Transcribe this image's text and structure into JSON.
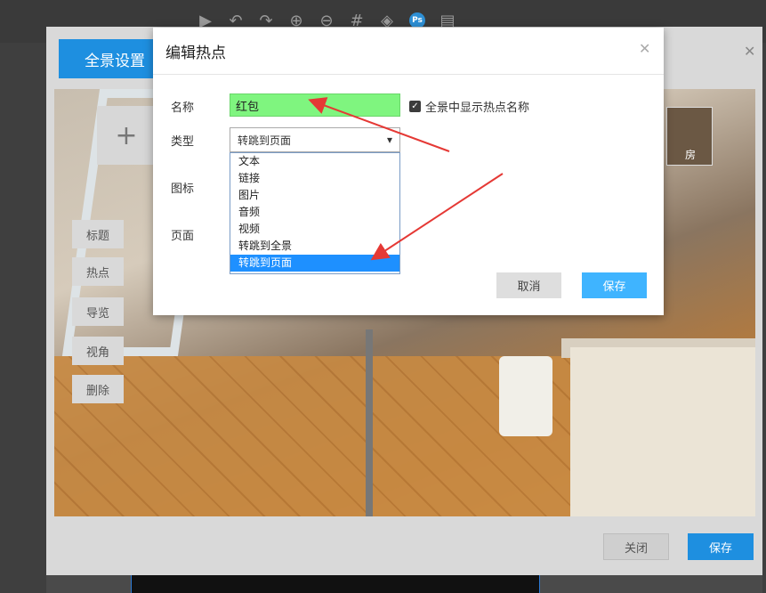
{
  "toolbar": {
    "icons": [
      "play-icon",
      "undo-icon",
      "redo-icon",
      "zoom-in-icon",
      "zoom-out-icon",
      "grid-icon",
      "layers-icon",
      "photoshop-icon",
      "save-icon"
    ],
    "ps_label": "Ps"
  },
  "pano_window": {
    "tab_label": "全景设置",
    "add_label": "+",
    "side_buttons": [
      "标题",
      "热点",
      "导览",
      "视角",
      "删除"
    ],
    "close_label": "关闭",
    "save_label": "保存",
    "thumb_caption": "房"
  },
  "dialog": {
    "title": "编辑热点",
    "fields": {
      "name_label": "名称",
      "type_label": "类型",
      "icon_label": "图标",
      "page_label": "页面"
    },
    "name_value": "红包",
    "show_name_label": "全景中显示热点名称",
    "show_name_checked": true,
    "type_selected": "转跳到页面",
    "type_options": [
      "文本",
      "链接",
      "图片",
      "音频",
      "视频",
      "转跳到全景",
      "转跳到页面"
    ],
    "cancel_label": "取消",
    "save_label": "保存"
  },
  "colors": {
    "accent": "#1e8fe0",
    "save_button": "#3fb4ff",
    "name_highlight": "#7ff57f",
    "arrow": "#e53935",
    "selected_option": "#1e90ff"
  }
}
